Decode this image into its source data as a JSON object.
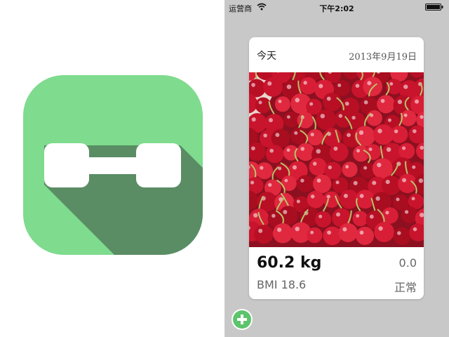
{
  "status_bar": {
    "carrier": "运营商",
    "time": "下午2:02",
    "wifi_icon": "wifi-icon",
    "battery_icon": "battery-icon"
  },
  "app_icon": {
    "name": "dumbbell-icon",
    "background_color": "#7fdb8e",
    "shadow_color": "#5a8d64"
  },
  "card": {
    "day_label": "今天",
    "date": "2013年9月19日",
    "photo": "cherries-photo",
    "weight": "60.2 kg",
    "change": "0.0",
    "bmi": "BMI 18.6",
    "status": "正常"
  },
  "add_button": {
    "icon": "plus-icon",
    "color": "#5cc46c"
  }
}
